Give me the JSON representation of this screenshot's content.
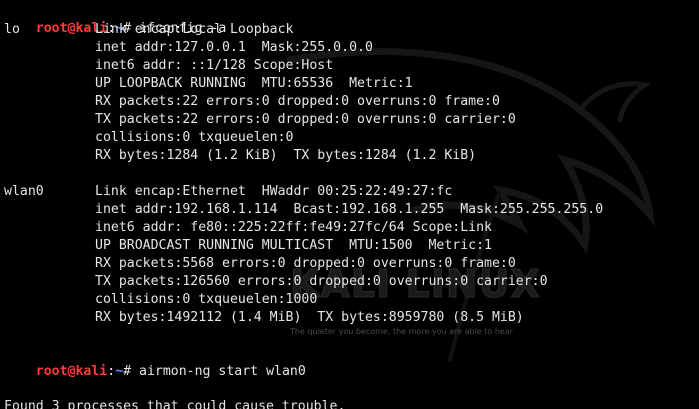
{
  "terminal": {
    "prompt_user": "root@kali",
    "prompt_sep": ":",
    "prompt_path": "~",
    "prompt_symbol": "#",
    "commands": [
      " ifconfig -a",
      " airmon-ng start wlan0"
    ],
    "interfaces": [
      {
        "name": "lo",
        "lines": [
          "Link encap:Local Loopback",
          "inet addr:127.0.0.1  Mask:255.0.0.0",
          "inet6 addr: ::1/128 Scope:Host",
          "UP LOOPBACK RUNNING  MTU:65536  Metric:1",
          "RX packets:22 errors:0 dropped:0 overruns:0 frame:0",
          "TX packets:22 errors:0 dropped:0 overruns:0 carrier:0",
          "collisions:0 txqueuelen:0",
          "RX bytes:1284 (1.2 KiB)  TX bytes:1284 (1.2 KiB)"
        ]
      },
      {
        "name": "wlan0",
        "lines": [
          "Link encap:Ethernet  HWaddr 00:25:22:49:27:fc",
          "inet addr:192.168.1.114  Bcast:192.168.1.255  Mask:255.255.255.0",
          "inet6 addr: fe80::225:22ff:fe49:27fc/64 Scope:Link",
          "UP BROADCAST RUNNING MULTICAST  MTU:1500  Metric:1",
          "RX packets:5568 errors:0 dropped:0 overruns:0 frame:0",
          "TX packets:126560 errors:0 dropped:0 overruns:0 carrier:0",
          "collisions:0 txqueuelen:1000",
          "RX bytes:1492112 (1.4 MiB)  TX bytes:8959780 (8.5 MiB)"
        ]
      }
    ],
    "trailing_output": "Found 3 processes that could cause trouble."
  },
  "watermark": {
    "logo_text": "KALI LINUX",
    "tagline": "The quieter you become, the more you are able to hear"
  },
  "colors": {
    "background": "#000000",
    "text": "#e6e6e6",
    "prompt_user": "#ff3b3b",
    "prompt_path": "#5b8cff"
  }
}
